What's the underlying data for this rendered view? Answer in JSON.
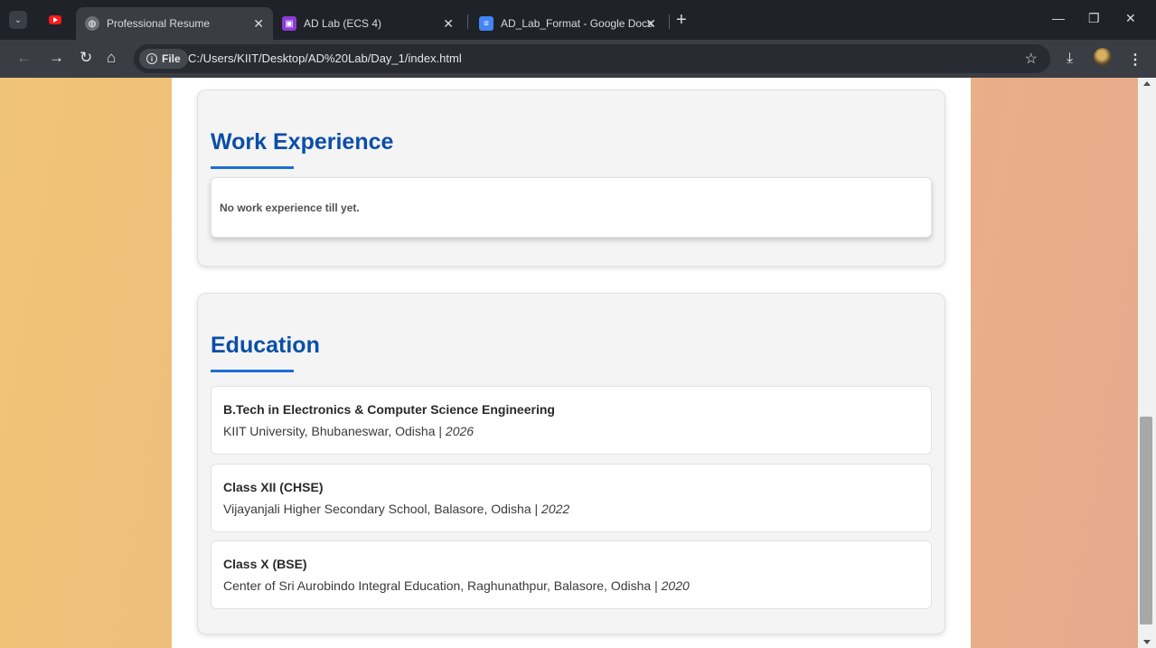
{
  "browser": {
    "tabs": [
      {
        "title": "Professional Resume",
        "active": true,
        "icon": "globe-icon"
      },
      {
        "title": "AD Lab (ECS 4)",
        "active": false,
        "icon": "classroom-icon"
      },
      {
        "title": "AD_Lab_Format - Google Docs",
        "active": false,
        "icon": "docs-icon"
      }
    ],
    "address_chip": "File",
    "url": "C:/Users/KIIT/Desktop/AD%20Lab/Day_1/index.html"
  },
  "work_experience": {
    "title": "Work Experience",
    "text": "No work experience till yet."
  },
  "education": {
    "title": "Education",
    "items": [
      {
        "degree": "B.Tech in Electronics & Computer Science Engineering",
        "institution": "KIIT University, Bhubaneswar, Odisha",
        "separator": " | ",
        "year": "2026"
      },
      {
        "degree": "Class XII (CHSE)",
        "institution": "Vijayanjali Higher Secondary School, Balasore, Odisha",
        "separator": " | ",
        "year": "2022"
      },
      {
        "degree": "Class X (BSE)",
        "institution": "Center of Sri Aurobindo Integral Education, Raghunathpur, Balasore, Odisha",
        "separator": " | ",
        "year": "2020"
      }
    ]
  },
  "colors": {
    "heading": "#0a4ea8",
    "underline": "#1d6ed6",
    "background_start": "#f0c476",
    "background_end": "#e7a98e"
  }
}
